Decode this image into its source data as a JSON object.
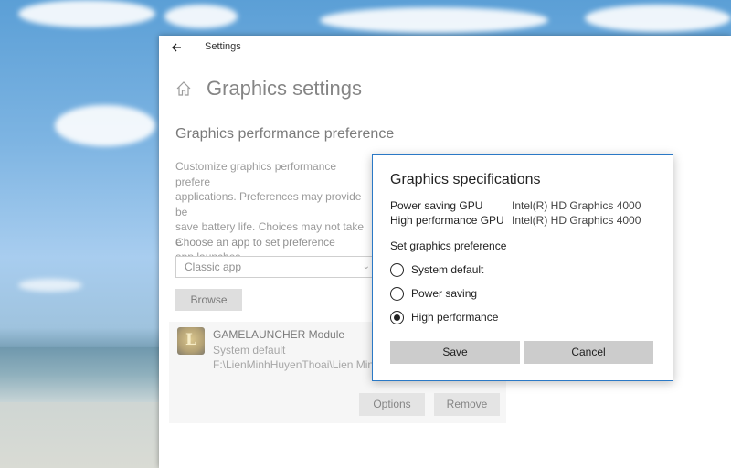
{
  "window": {
    "title": "Settings"
  },
  "page": {
    "title": "Graphics settings",
    "section_heading": "Graphics performance preference",
    "description": "Customize graphics performance prefere\napplications. Preferences may provide be\nsave battery life. Choices may not take e\napp launches.",
    "choose_label": "Choose an app to set preference",
    "app_type_select": "Classic app",
    "browse_label": "Browse"
  },
  "app_card": {
    "name": "GAMELAUNCHER Module",
    "preference": "System default",
    "path": "F:\\LienMinhHuyenThoai\\Lien Minh",
    "icon_letter": "L",
    "options_label": "Options",
    "remove_label": "Remove"
  },
  "dialog": {
    "title": "Graphics specifications",
    "specs": [
      {
        "label": "Power saving GPU",
        "value": "Intel(R) HD Graphics 4000"
      },
      {
        "label": "High performance GPU",
        "value": "Intel(R) HD Graphics 4000"
      }
    ],
    "preference_label": "Set graphics preference",
    "options": [
      {
        "label": "System default",
        "checked": false
      },
      {
        "label": "Power saving",
        "checked": false
      },
      {
        "label": "High performance",
        "checked": true
      }
    ],
    "save_label": "Save",
    "cancel_label": "Cancel"
  },
  "colors": {
    "accent_border": "#2b79c6",
    "button_gray": "#cccccc"
  }
}
